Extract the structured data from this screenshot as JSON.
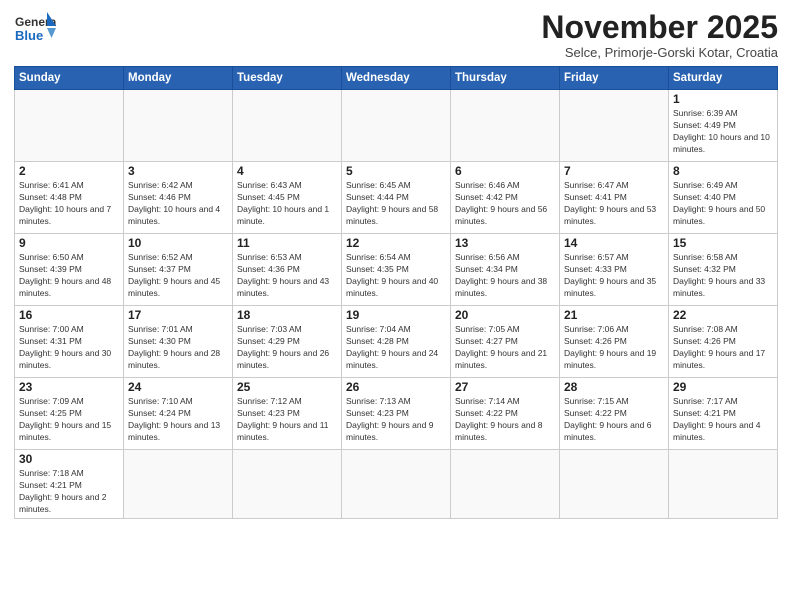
{
  "header": {
    "logo_general": "General",
    "logo_blue": "Blue",
    "month_title": "November 2025",
    "subtitle": "Selce, Primorje-Gorski Kotar, Croatia"
  },
  "days_of_week": [
    "Sunday",
    "Monday",
    "Tuesday",
    "Wednesday",
    "Thursday",
    "Friday",
    "Saturday"
  ],
  "weeks": [
    [
      {
        "day": "",
        "info": ""
      },
      {
        "day": "",
        "info": ""
      },
      {
        "day": "",
        "info": ""
      },
      {
        "day": "",
        "info": ""
      },
      {
        "day": "",
        "info": ""
      },
      {
        "day": "",
        "info": ""
      },
      {
        "day": "1",
        "info": "Sunrise: 6:39 AM\nSunset: 4:49 PM\nDaylight: 10 hours and 10 minutes."
      }
    ],
    [
      {
        "day": "2",
        "info": "Sunrise: 6:41 AM\nSunset: 4:48 PM\nDaylight: 10 hours and 7 minutes."
      },
      {
        "day": "3",
        "info": "Sunrise: 6:42 AM\nSunset: 4:46 PM\nDaylight: 10 hours and 4 minutes."
      },
      {
        "day": "4",
        "info": "Sunrise: 6:43 AM\nSunset: 4:45 PM\nDaylight: 10 hours and 1 minute."
      },
      {
        "day": "5",
        "info": "Sunrise: 6:45 AM\nSunset: 4:44 PM\nDaylight: 9 hours and 58 minutes."
      },
      {
        "day": "6",
        "info": "Sunrise: 6:46 AM\nSunset: 4:42 PM\nDaylight: 9 hours and 56 minutes."
      },
      {
        "day": "7",
        "info": "Sunrise: 6:47 AM\nSunset: 4:41 PM\nDaylight: 9 hours and 53 minutes."
      },
      {
        "day": "8",
        "info": "Sunrise: 6:49 AM\nSunset: 4:40 PM\nDaylight: 9 hours and 50 minutes."
      }
    ],
    [
      {
        "day": "9",
        "info": "Sunrise: 6:50 AM\nSunset: 4:39 PM\nDaylight: 9 hours and 48 minutes."
      },
      {
        "day": "10",
        "info": "Sunrise: 6:52 AM\nSunset: 4:37 PM\nDaylight: 9 hours and 45 minutes."
      },
      {
        "day": "11",
        "info": "Sunrise: 6:53 AM\nSunset: 4:36 PM\nDaylight: 9 hours and 43 minutes."
      },
      {
        "day": "12",
        "info": "Sunrise: 6:54 AM\nSunset: 4:35 PM\nDaylight: 9 hours and 40 minutes."
      },
      {
        "day": "13",
        "info": "Sunrise: 6:56 AM\nSunset: 4:34 PM\nDaylight: 9 hours and 38 minutes."
      },
      {
        "day": "14",
        "info": "Sunrise: 6:57 AM\nSunset: 4:33 PM\nDaylight: 9 hours and 35 minutes."
      },
      {
        "day": "15",
        "info": "Sunrise: 6:58 AM\nSunset: 4:32 PM\nDaylight: 9 hours and 33 minutes."
      }
    ],
    [
      {
        "day": "16",
        "info": "Sunrise: 7:00 AM\nSunset: 4:31 PM\nDaylight: 9 hours and 30 minutes."
      },
      {
        "day": "17",
        "info": "Sunrise: 7:01 AM\nSunset: 4:30 PM\nDaylight: 9 hours and 28 minutes."
      },
      {
        "day": "18",
        "info": "Sunrise: 7:03 AM\nSunset: 4:29 PM\nDaylight: 9 hours and 26 minutes."
      },
      {
        "day": "19",
        "info": "Sunrise: 7:04 AM\nSunset: 4:28 PM\nDaylight: 9 hours and 24 minutes."
      },
      {
        "day": "20",
        "info": "Sunrise: 7:05 AM\nSunset: 4:27 PM\nDaylight: 9 hours and 21 minutes."
      },
      {
        "day": "21",
        "info": "Sunrise: 7:06 AM\nSunset: 4:26 PM\nDaylight: 9 hours and 19 minutes."
      },
      {
        "day": "22",
        "info": "Sunrise: 7:08 AM\nSunset: 4:26 PM\nDaylight: 9 hours and 17 minutes."
      }
    ],
    [
      {
        "day": "23",
        "info": "Sunrise: 7:09 AM\nSunset: 4:25 PM\nDaylight: 9 hours and 15 minutes."
      },
      {
        "day": "24",
        "info": "Sunrise: 7:10 AM\nSunset: 4:24 PM\nDaylight: 9 hours and 13 minutes."
      },
      {
        "day": "25",
        "info": "Sunrise: 7:12 AM\nSunset: 4:23 PM\nDaylight: 9 hours and 11 minutes."
      },
      {
        "day": "26",
        "info": "Sunrise: 7:13 AM\nSunset: 4:23 PM\nDaylight: 9 hours and 9 minutes."
      },
      {
        "day": "27",
        "info": "Sunrise: 7:14 AM\nSunset: 4:22 PM\nDaylight: 9 hours and 8 minutes."
      },
      {
        "day": "28",
        "info": "Sunrise: 7:15 AM\nSunset: 4:22 PM\nDaylight: 9 hours and 6 minutes."
      },
      {
        "day": "29",
        "info": "Sunrise: 7:17 AM\nSunset: 4:21 PM\nDaylight: 9 hours and 4 minutes."
      }
    ],
    [
      {
        "day": "30",
        "info": "Sunrise: 7:18 AM\nSunset: 4:21 PM\nDaylight: 9 hours and 2 minutes."
      },
      {
        "day": "",
        "info": ""
      },
      {
        "day": "",
        "info": ""
      },
      {
        "day": "",
        "info": ""
      },
      {
        "day": "",
        "info": ""
      },
      {
        "day": "",
        "info": ""
      },
      {
        "day": "",
        "info": ""
      }
    ]
  ]
}
